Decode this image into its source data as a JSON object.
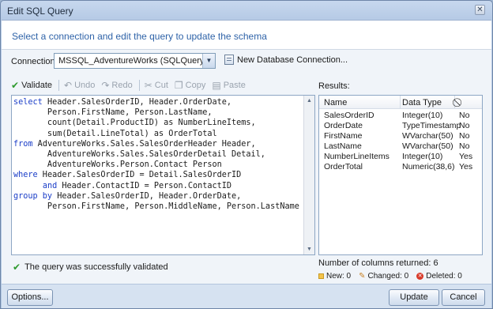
{
  "window": {
    "title": "Edit SQL Query",
    "close_glyph": "✕"
  },
  "header": {
    "text": "Select a connection and edit the query to update the schema"
  },
  "connection": {
    "label": "Connection:",
    "selected": "MSSQL_AdventureWorks (SQLQuery)",
    "new_connection_label": "New Database Connection..."
  },
  "toolbar": {
    "validate": "Validate",
    "undo": "Undo",
    "redo": "Redo",
    "cut": "Cut",
    "copy": "Copy",
    "paste": "Paste"
  },
  "editor": {
    "lines": [
      [
        {
          "k": "select"
        },
        {
          "t": " Header.SalesOrderID, Header.OrderDate,"
        }
      ],
      [
        {
          "t": "       Person.FirstName, Person.LastName,"
        }
      ],
      [
        {
          "t": "       count(Detail.ProductID) as NumberLineItems,"
        }
      ],
      [
        {
          "t": "       sum(Detail.LineTotal) as OrderTotal"
        }
      ],
      [
        {
          "k": "from"
        },
        {
          "t": " AdventureWorks.Sales.SalesOrderHeader Header,"
        }
      ],
      [
        {
          "t": "       AdventureWorks.Sales.SalesOrderDetail Detail,"
        }
      ],
      [
        {
          "t": "       AdventureWorks.Person.Contact Person"
        }
      ],
      [
        {
          "k": "where"
        },
        {
          "t": " Header.SalesOrderID = Detail.SalesOrderID"
        }
      ],
      [
        {
          "t": "      "
        },
        {
          "k": "and"
        },
        {
          "t": " Header.ContactID = Person.ContactID"
        }
      ],
      [
        {
          "k": "group by"
        },
        {
          "t": " Header.SalesOrderID, Header.OrderDate,"
        }
      ],
      [
        {
          "t": "       Person.FirstName, Person.MiddleName, Person.LastName"
        }
      ]
    ]
  },
  "results": {
    "label": "Results:",
    "columns": [
      "Name",
      "Data Type",
      "⃠"
    ],
    "rows": [
      [
        "SalesOrderID",
        "Integer(10)",
        "No"
      ],
      [
        "OrderDate",
        "TypeTimestamp",
        "No"
      ],
      [
        "FirstName",
        "WVarchar(50)",
        "No"
      ],
      [
        "LastName",
        "WVarchar(50)",
        "No"
      ],
      [
        "NumberLineItems",
        "Integer(10)",
        "Yes"
      ],
      [
        "OrderTotal",
        "Numeric(38,6)",
        "Yes"
      ]
    ]
  },
  "status": {
    "validated": "The query was successfully validated"
  },
  "summary": {
    "columns_returned": "Number of columns returned:  6",
    "new": "New: 0",
    "changed": "Changed: 0",
    "deleted": "Deleted: 0"
  },
  "footer": {
    "options": "Options...",
    "update": "Update",
    "cancel": "Cancel"
  },
  "colors": {
    "accent": "#2f63a8",
    "keyword": "#1b3ec8",
    "success": "#2e9a2e"
  }
}
